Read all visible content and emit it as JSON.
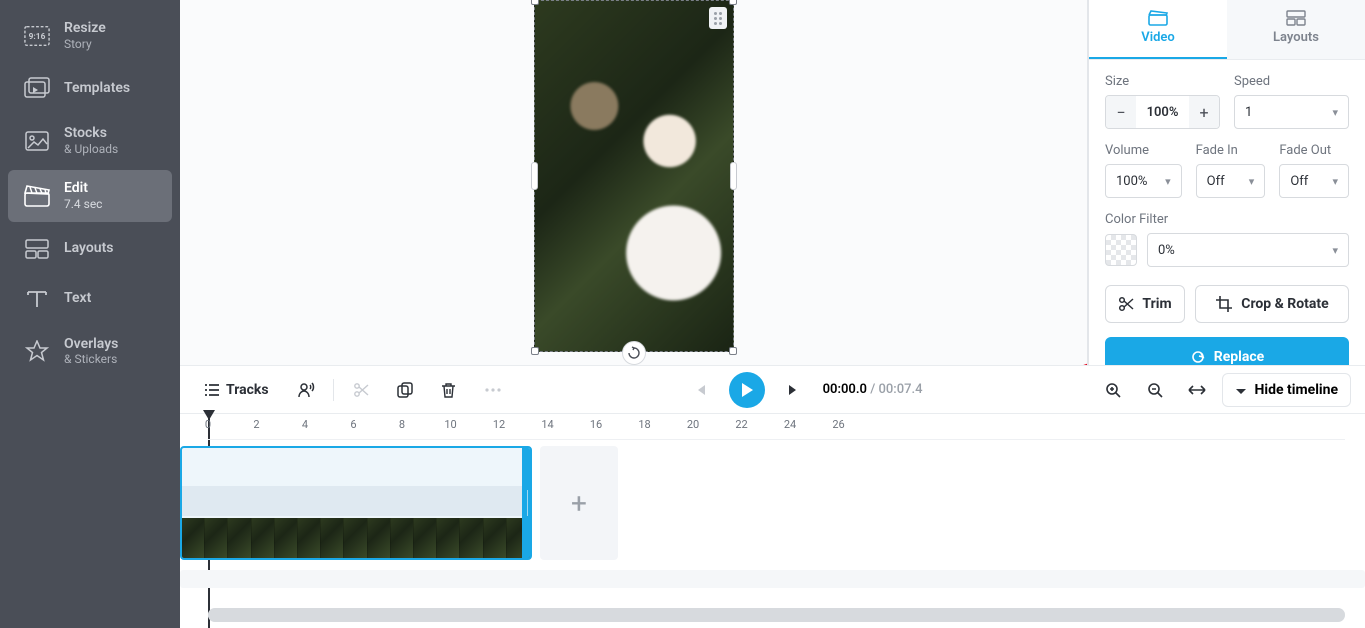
{
  "sidebar": {
    "items": [
      {
        "title": "Resize",
        "sub": "Story",
        "badge": "9:16"
      },
      {
        "title": "Templates",
        "sub": ""
      },
      {
        "title": "Stocks",
        "sub": "& Uploads"
      },
      {
        "title": "Edit",
        "sub": "7.4 sec"
      },
      {
        "title": "Layouts",
        "sub": ""
      },
      {
        "title": "Text",
        "sub": ""
      },
      {
        "title": "Overlays",
        "sub": "& Stickers"
      }
    ]
  },
  "right_panel": {
    "tabs": {
      "video": "Video",
      "layouts": "Layouts"
    },
    "size": {
      "label": "Size",
      "value": "100%"
    },
    "speed": {
      "label": "Speed",
      "value": "1"
    },
    "volume": {
      "label": "Volume",
      "value": "100%"
    },
    "fade_in": {
      "label": "Fade In",
      "value": "Off"
    },
    "fade_out": {
      "label": "Fade Out",
      "value": "Off"
    },
    "color_filter": {
      "label": "Color Filter",
      "value": "0%"
    },
    "trim": "Trim",
    "crop_rotate": "Crop & Rotate",
    "replace": "Replace"
  },
  "toolbar": {
    "tracks": "Tracks",
    "time_current": "00:00.0",
    "time_sep": " / ",
    "time_total": "00:07.4",
    "hide_timeline": "Hide timeline"
  },
  "timeline": {
    "ticks": [
      "0",
      "2",
      "4",
      "6",
      "8",
      "10",
      "12",
      "14",
      "16",
      "18",
      "20",
      "22",
      "24",
      "26"
    ]
  }
}
